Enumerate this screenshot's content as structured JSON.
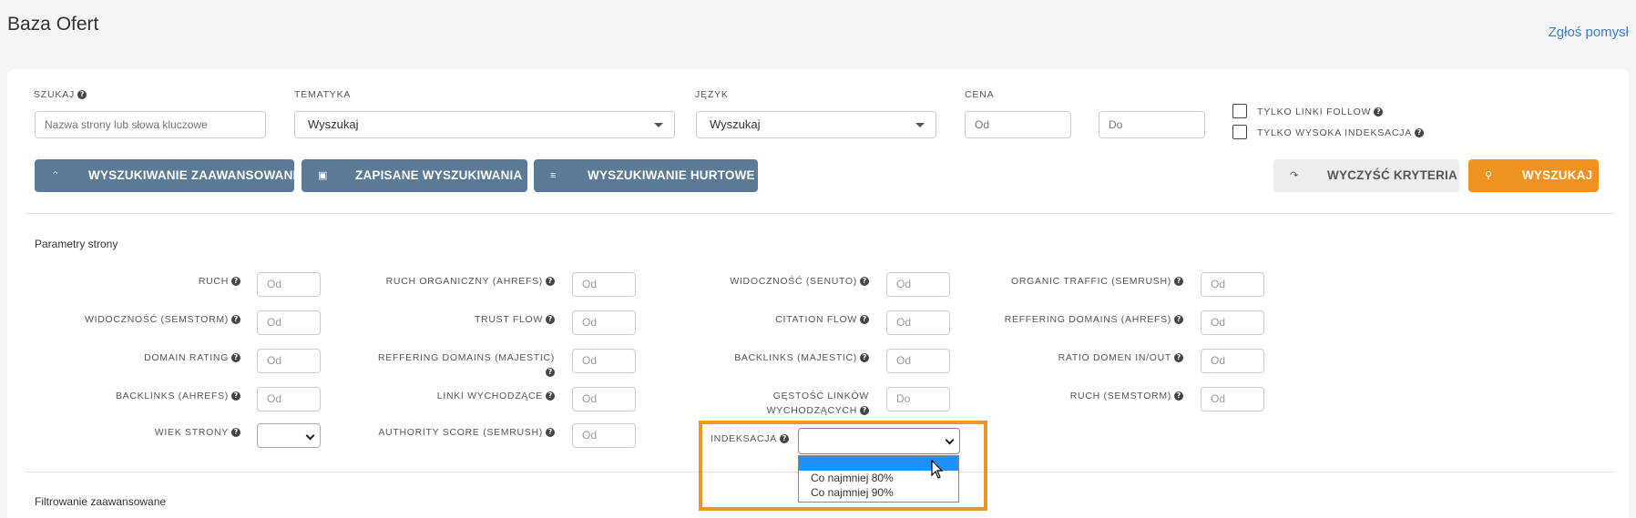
{
  "header": {
    "title": "Baza Ofert",
    "report_link": "Zgłoś pomysł"
  },
  "filters": {
    "search": {
      "label": "SZUKAJ",
      "placeholder": "Nazwa strony lub słowa kluczowe"
    },
    "topic": {
      "label": "TEMATYKA",
      "value": "Wyszukaj"
    },
    "language": {
      "label": "JĘZYK",
      "value": "Wyszukaj"
    },
    "price": {
      "label": "CENA",
      "from_placeholder": "Od",
      "to_placeholder": "Do"
    },
    "follow_only": {
      "label": "TYLKO LINKI FOLLOW",
      "checked": false
    },
    "high_index_only": {
      "label": "TYLKO WYSOKA INDEKSACJA",
      "checked": false
    }
  },
  "buttons": {
    "advanced": "WYSZUKIWANIE ZAAWANSOWANE",
    "saved": "ZAPISANE WYSZUKIWANIA",
    "bulk": "WYSZUKIWANIE HURTOWE",
    "clear": "WYCZYŚĆ KRYTERIA",
    "search": "WYSZUKAJ"
  },
  "site_params": {
    "title": "Parametry strony",
    "fields": [
      {
        "label": "RUCH",
        "placeholder": "Od"
      },
      {
        "label": "RUCH ORGANICZNY (AHREFS)",
        "placeholder": "Od"
      },
      {
        "label": "WIDOCZNOŚĆ (SENUTO)",
        "placeholder": "Od"
      },
      {
        "label": "ORGANIC TRAFFIC (SEMRUSH)",
        "placeholder": "Od"
      },
      {
        "label": "WIDOCZNOŚĆ (SEMSTORM)",
        "placeholder": "Od"
      },
      {
        "label": "TRUST FLOW",
        "placeholder": "Od"
      },
      {
        "label": "CITATION FLOW",
        "placeholder": "Od"
      },
      {
        "label": "REFFERING DOMAINS (AHREFS)",
        "placeholder": "Od"
      },
      {
        "label": "DOMAIN RATING",
        "placeholder": "Od"
      },
      {
        "label": "REFFERING DOMAINS (MAJESTIC)",
        "placeholder": "Od"
      },
      {
        "label": "BACKLINKS (MAJESTIC)",
        "placeholder": "Od"
      },
      {
        "label": "RATIO DOMEN IN/OUT",
        "placeholder": "Od"
      },
      {
        "label": "BACKLINKS (AHREFS)",
        "placeholder": "Od"
      },
      {
        "label": "LINKI WYCHODZĄCE",
        "placeholder": "Od"
      },
      {
        "label": "GĘSTOŚĆ LINKÓW WYCHODZĄCYCH",
        "placeholder": "Do"
      },
      {
        "label": "RUCH (SEMSTORM)",
        "placeholder": "Od"
      },
      {
        "label": "WIEK STRONY",
        "placeholder": ""
      },
      {
        "label": "AUTHORITY SCORE (SEMRUSH)",
        "placeholder": "Od"
      }
    ],
    "indexation": {
      "label": "INDEKSACJA",
      "value": "",
      "options": [
        "",
        "Co najmniej 80%",
        "Co najmniej 90%"
      ]
    }
  },
  "advanced_filtering": {
    "title": "Filtrowanie zaawansowane"
  },
  "colors": {
    "accent_orange": "#f0921f",
    "button_blue": "#5b7a96",
    "link_blue": "#3a7ec8",
    "highlight": "#e8952a"
  },
  "icons": {
    "help": "question-circle-icon",
    "advanced": "chevron-up-icon",
    "saved": "floppy-disk-icon",
    "bulk": "list-icon",
    "clear": "redo-icon",
    "search": "magnifier-icon"
  }
}
